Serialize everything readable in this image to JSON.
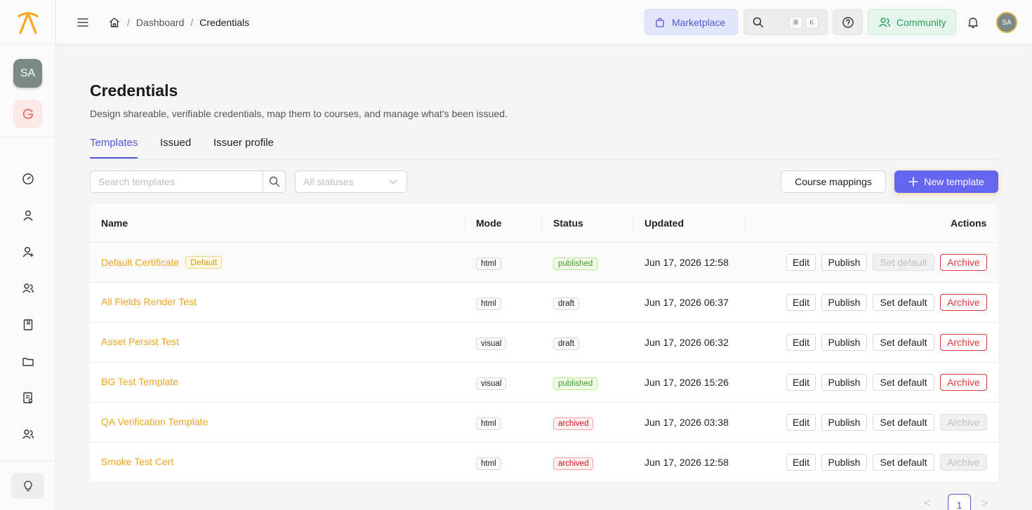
{
  "sidebar": {
    "avatar_initials": "SA",
    "nav_icons": [
      "dashboard-icon",
      "user-icon",
      "user-add-icon",
      "users-icon",
      "book-icon",
      "folder-icon",
      "certificate-icon",
      "team-icon"
    ],
    "bottom_icon": "lightbulb-icon"
  },
  "header": {
    "breadcrumb": {
      "home_icon": "home-icon",
      "parent": "Dashboard",
      "current": "Credentials"
    },
    "marketplace_label": "Marketplace",
    "search_kbd": [
      "⌘",
      "K"
    ],
    "community_label": "Community",
    "avatar_initials": "SA"
  },
  "page": {
    "title": "Credentials",
    "subtitle": "Design shareable, verifiable credentials, map them to courses, and manage what's been issued.",
    "tabs": [
      {
        "label": "Templates",
        "active": true
      },
      {
        "label": "Issued",
        "active": false
      },
      {
        "label": "Issuer profile",
        "active": false
      }
    ]
  },
  "toolbar": {
    "search_placeholder": "Search templates",
    "status_placeholder": "All statuses",
    "course_mappings_label": "Course mappings",
    "new_template_label": "New template"
  },
  "table": {
    "columns": [
      "Name",
      "Mode",
      "Status",
      "Updated",
      "Actions"
    ],
    "rows": [
      {
        "name": "Default Certificate",
        "badge": "Default",
        "mode": "html",
        "status": "published",
        "updated": "Jun 17, 2026 12:58",
        "set_default_disabled": true,
        "archive_disabled": false
      },
      {
        "name": "All Fields Render Test",
        "badge": "",
        "mode": "html",
        "status": "draft",
        "updated": "Jun 17, 2026 06:37",
        "set_default_disabled": false,
        "archive_disabled": false
      },
      {
        "name": "Asset Persist Test",
        "badge": "",
        "mode": "visual",
        "status": "draft",
        "updated": "Jun 17, 2026 06:32",
        "set_default_disabled": false,
        "archive_disabled": false
      },
      {
        "name": "BG Test Template",
        "badge": "",
        "mode": "visual",
        "status": "published",
        "updated": "Jun 17, 2026 15:26",
        "set_default_disabled": false,
        "archive_disabled": false
      },
      {
        "name": "QA Verification Template",
        "badge": "",
        "mode": "html",
        "status": "archived",
        "updated": "Jun 17, 2026 03:38",
        "set_default_disabled": false,
        "archive_disabled": true
      },
      {
        "name": "Smoke Test Cert",
        "badge": "",
        "mode": "html",
        "status": "archived",
        "updated": "Jun 17, 2026 12:58",
        "set_default_disabled": false,
        "archive_disabled": true
      }
    ],
    "action_labels": {
      "edit": "Edit",
      "publish": "Publish",
      "set_default": "Set default",
      "archive": "Archive"
    }
  },
  "pagination": {
    "current_page": "1",
    "prev_icon": "chevron-left-icon",
    "next_icon": "chevron-right-icon"
  },
  "colors": {
    "accent": "#6465f1",
    "name_link": "#eda51c",
    "danger": "#e5383b",
    "success": "#3d9b25"
  }
}
